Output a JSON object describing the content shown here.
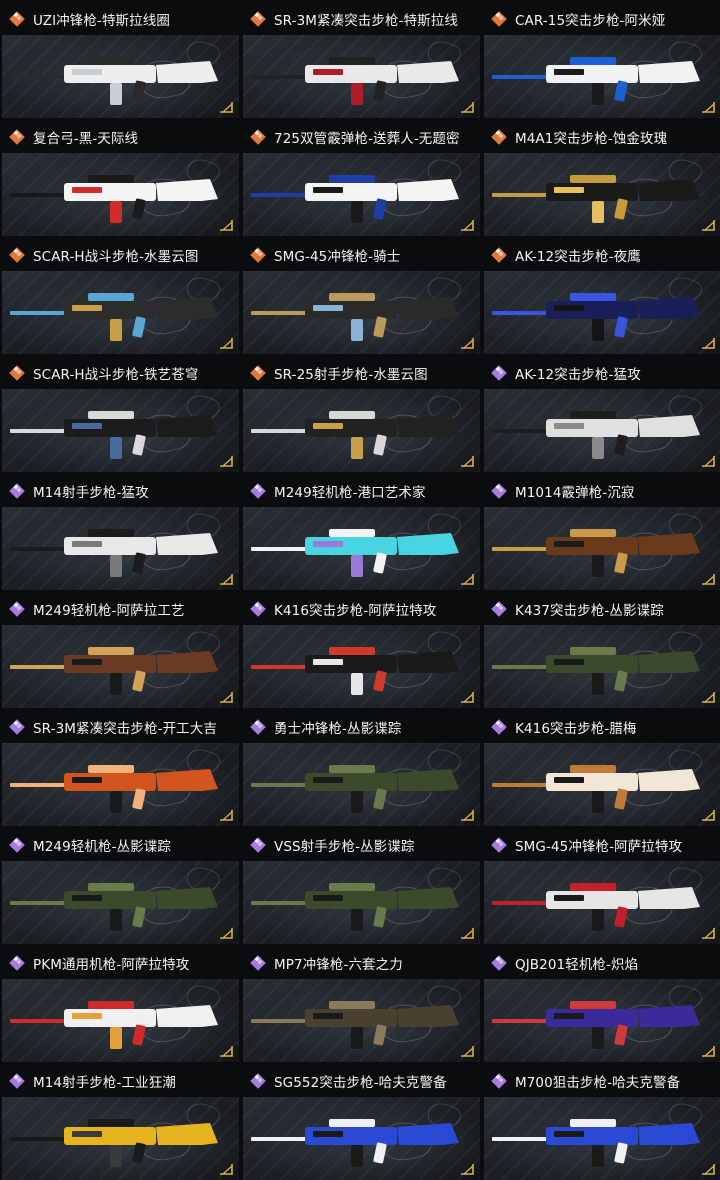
{
  "colors": {
    "legendary": "#e07a3c",
    "epic": "#a77be0",
    "background": "#0b0c0e",
    "accent_corner": "#d9b04a"
  },
  "skins": [
    {
      "title": "UZI冲锋枪-特斯拉线圈",
      "rarity": "legendary",
      "icon": "diamond-legendary-icon",
      "palette": [
        "#eeeeee",
        "#2a2a2a",
        "#c9ced6"
      ]
    },
    {
      "title": "SR-3M紧凑突击步枪-特斯拉线",
      "rarity": "legendary",
      "icon": "diamond-legendary-icon",
      "palette": [
        "#e9e9e9",
        "#222222",
        "#b01d2a"
      ]
    },
    {
      "title": "CAR-15突击步枪-阿米娅",
      "rarity": "legendary",
      "icon": "diamond-legendary-icon",
      "palette": [
        "#f2f2f2",
        "#1f5fd6",
        "#1b1b1b"
      ]
    },
    {
      "title": "复合弓-黑-天际线",
      "rarity": "legendary",
      "icon": "diamond-legendary-icon",
      "palette": [
        "#f4f4f4",
        "#1a1a1a",
        "#d12b2b"
      ]
    },
    {
      "title": "725双管霰弹枪-送葬人-无题密",
      "rarity": "legendary",
      "icon": "diamond-legendary-icon",
      "palette": [
        "#f4f4f4",
        "#1d3fa5",
        "#1a1a1a"
      ]
    },
    {
      "title": "M4A1突击步枪-蚀金玫瑰",
      "rarity": "legendary",
      "icon": "diamond-legendary-icon",
      "palette": [
        "#1a1a1a",
        "#c79a3a",
        "#e6c060"
      ]
    },
    {
      "title": "SCAR-H战斗步枪-水墨云图",
      "rarity": "legendary",
      "icon": "diamond-legendary-icon",
      "palette": [
        "#2c2c2c",
        "#5aa7d6",
        "#c9a04a"
      ]
    },
    {
      "title": "SMG-45冲锋枪-骑士",
      "rarity": "legendary",
      "icon": "diamond-legendary-icon",
      "palette": [
        "#2a2a2a",
        "#b99b5b",
        "#8ab4d6"
      ]
    },
    {
      "title": "AK-12突击步枪-夜鹰",
      "rarity": "legendary",
      "icon": "diamond-legendary-icon",
      "palette": [
        "#1a1f5a",
        "#3a56e0",
        "#151515"
      ]
    },
    {
      "title": "SCAR-H战斗步枪-铁艺苍穹",
      "rarity": "legendary",
      "icon": "diamond-legendary-icon",
      "palette": [
        "#1c1c1c",
        "#d9d9d9",
        "#4a6a9a"
      ]
    },
    {
      "title": "SR-25射手步枪-水墨云图",
      "rarity": "legendary",
      "icon": "diamond-legendary-icon",
      "palette": [
        "#222222",
        "#d7d7d7",
        "#c9a04a"
      ]
    },
    {
      "title": "AK-12突击步枪-猛攻",
      "rarity": "epic",
      "icon": "diamond-epic-icon",
      "palette": [
        "#e0e0e0",
        "#1e1e1e",
        "#8a8a8a"
      ]
    },
    {
      "title": "M14射手步枪-猛攻",
      "rarity": "epic",
      "icon": "diamond-epic-icon",
      "palette": [
        "#e8e8e8",
        "#1c1c1c",
        "#7a7a7a"
      ]
    },
    {
      "title": "M249轻机枪-港口艺术家",
      "rarity": "epic",
      "icon": "diamond-epic-icon",
      "palette": [
        "#48d4e0",
        "#f2f2f2",
        "#9a7ad6"
      ]
    },
    {
      "title": "M1014霰弹枪-沉寂",
      "rarity": "epic",
      "icon": "diamond-epic-icon",
      "palette": [
        "#6a3a1c",
        "#c99a4a",
        "#1a1a1a"
      ]
    },
    {
      "title": "M249轻机枪-阿萨拉工艺",
      "rarity": "epic",
      "icon": "diamond-epic-icon",
      "palette": [
        "#6a3a24",
        "#d1a25a",
        "#1a1a1a"
      ]
    },
    {
      "title": "K416突击步枪-阿萨拉特攻",
      "rarity": "epic",
      "icon": "diamond-epic-icon",
      "palette": [
        "#1a1a1a",
        "#d03a2a",
        "#e6e6e6"
      ]
    },
    {
      "title": "K437突击步枪-丛影谍踪",
      "rarity": "epic",
      "icon": "diamond-epic-icon",
      "palette": [
        "#3a4a2a",
        "#6a7a4a",
        "#1a1a1a"
      ]
    },
    {
      "title": "SR-3M紧凑突击步枪-开工大吉",
      "rarity": "epic",
      "icon": "diamond-epic-icon",
      "palette": [
        "#d2541e",
        "#f2b07a",
        "#1a1a1a"
      ]
    },
    {
      "title": "勇士冲锋枪-丛影谍踪",
      "rarity": "epic",
      "icon": "diamond-epic-icon",
      "palette": [
        "#3a4a2a",
        "#6a7a4a",
        "#1a1a1a"
      ]
    },
    {
      "title": "K416突击步枪-腊梅",
      "rarity": "epic",
      "icon": "diamond-epic-icon",
      "palette": [
        "#f2e6d6",
        "#c27a3a",
        "#1a1a1a"
      ]
    },
    {
      "title": "M249轻机枪-丛影谍踪",
      "rarity": "epic",
      "icon": "diamond-epic-icon",
      "palette": [
        "#3a4a2a",
        "#6a7a4a",
        "#1a1a1a"
      ]
    },
    {
      "title": "VSS射手步枪-丛影谍踪",
      "rarity": "epic",
      "icon": "diamond-epic-icon",
      "palette": [
        "#3a4a2a",
        "#6a7a4a",
        "#1a1a1a"
      ]
    },
    {
      "title": "SMG-45冲锋枪-阿萨拉特攻",
      "rarity": "epic",
      "icon": "diamond-epic-icon",
      "palette": [
        "#e6e6e6",
        "#c4202a",
        "#1a1a1a"
      ]
    },
    {
      "title": "PKM通用机枪-阿萨拉特攻",
      "rarity": "epic",
      "icon": "diamond-epic-icon",
      "palette": [
        "#f0f0f0",
        "#d02a2a",
        "#e6a03a"
      ]
    },
    {
      "title": "MP7冲锋枪-六套之力",
      "rarity": "epic",
      "icon": "diamond-epic-icon",
      "palette": [
        "#4a4030",
        "#8a7a5a",
        "#1a1a1a"
      ]
    },
    {
      "title": "QJB201轻机枪-炽焰",
      "rarity": "epic",
      "icon": "diamond-epic-icon",
      "palette": [
        "#3a2a9a",
        "#d03a3a",
        "#1a1a1a"
      ]
    },
    {
      "title": "M14射手步枪-工业狂潮",
      "rarity": "epic",
      "icon": "diamond-epic-icon",
      "palette": [
        "#e6b41e",
        "#1a1a1a",
        "#3a3a3a"
      ]
    },
    {
      "title": "SG552突击步枪-哈夫克警备",
      "rarity": "epic",
      "icon": "diamond-epic-icon",
      "palette": [
        "#2a4ad6",
        "#f0f0f0",
        "#1a1a1a"
      ]
    },
    {
      "title": "M700狙击步枪-哈夫克警备",
      "rarity": "epic",
      "icon": "diamond-epic-icon",
      "palette": [
        "#2a4ad6",
        "#f0f0f0",
        "#1a1a1a"
      ]
    }
  ]
}
